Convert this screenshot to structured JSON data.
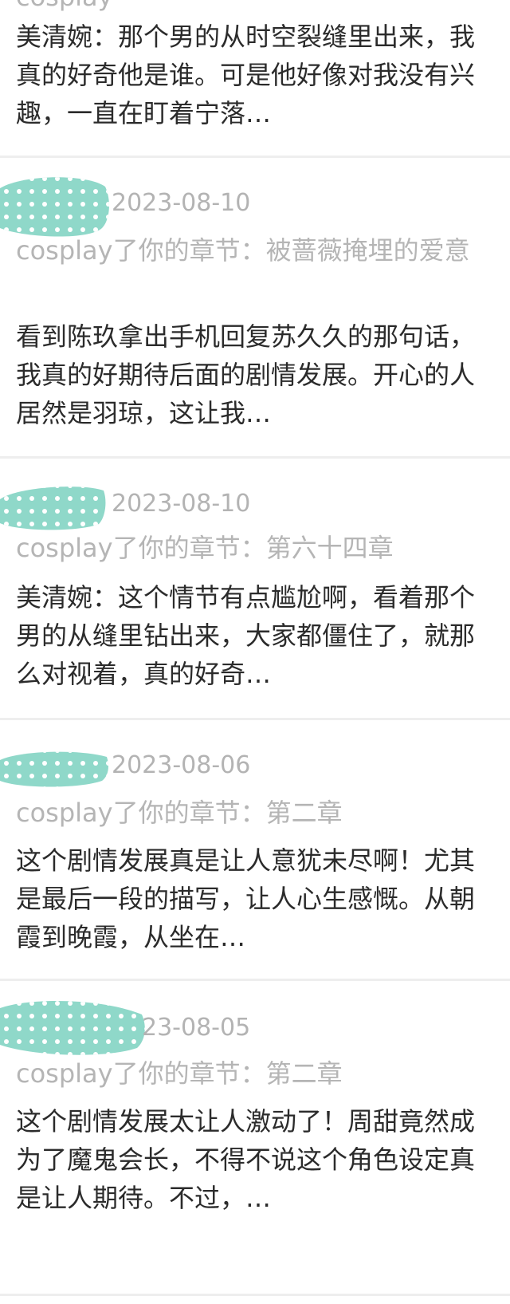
{
  "colors": {
    "accent_scribble": "#8fd8c9",
    "date_text": "#b3b3b3",
    "subtitle_text": "#b5b5b5",
    "content_text": "#2b2b2b",
    "separator": "#eeeeee"
  },
  "top_fragment": {
    "subtitle_cut": "cosplay",
    "content": "美清婉：那个男的从时空裂缝里出来，我真的好奇他是谁。可是他好像对我没有兴趣，一直在盯着宁落…"
  },
  "comments": [
    {
      "date": "2023-08-10",
      "subtitle": "cosplay了你的章节：被蔷薇掩埋的爱意",
      "content": "看到陈玖拿出手机回复苏久久的那句话，我真的好期待后面的剧情发展。开心的人居然是羽琼，这让我…"
    },
    {
      "date": "2023-08-10",
      "subtitle": "cosplay了你的章节：第六十四章",
      "content": "美清婉：这个情节有点尴尬啊，看着那个男的从缝里钻出来，大家都僵住了，就那么对视着，真的好奇…"
    },
    {
      "date": "2023-08-06",
      "subtitle": "cosplay了你的章节：第二章",
      "content": "这个剧情发展真是让人意犹未尽啊！尤其是最后一段的描写，让人心生感慨。从朝霞到晚霞，从坐在…"
    },
    {
      "date": "23-08-05",
      "subtitle": "cosplay了你的章节：第二章",
      "content": "这个剧情发展太让人激动了！周甜竟然成为了魔鬼会长，不得不说这个角色设定真是让人期待。不过，…"
    }
  ]
}
